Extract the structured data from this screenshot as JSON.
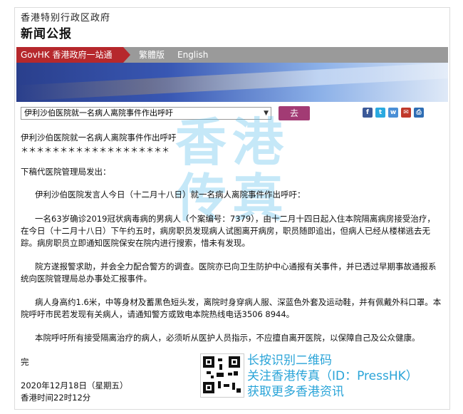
{
  "header": {
    "subtitle": "香港特别行政区政府",
    "title": "新闻公报"
  },
  "nav": {
    "govhk": "GovHK 香港政府一站通",
    "traditional": "繁體版",
    "english": "English"
  },
  "toolbar": {
    "select_value": "伊利沙伯医院就一名病人离院事件作出呼吁",
    "go_label": "去"
  },
  "share_icons": [
    "facebook-icon",
    "twitter-icon",
    "weibo-icon",
    "email-icon",
    "print-icon"
  ],
  "article": {
    "headline": "伊利沙伯医院就一名病人离院事件作出呼吁",
    "stars": "＊＊＊＊＊＊＊＊＊＊＊＊＊＊＊＊＊＊＊",
    "intro": "下稿代医院管理局发出：",
    "p1": "伊利沙伯医院发言人今日（十二月十八日）就一名病人离院事件作出呼吁：",
    "p2_l1": "一名63岁确诊2019冠状病毒病的男病人（个案编号：7379），由十二月十四日起入住本院隔离病房接受治疗，",
    "p2_l2": "在今日（十二月十八日）下午约五时，病房职员发现病人试图离开病房，职员随即追出，但病人已经从楼梯逃去无",
    "p2_l3": "踪。病房职员立即通知医院保安在院内进行搜索，惜未有发现。",
    "p3_l1": "院方遂报警求助，并会全力配合警方的调查。医院亦已向卫生防护中心通报有关事件，并已透过早期事故通报系",
    "p3_l2": "统向医院管理局总办事处汇报事件。",
    "p4_l1": "病人身高约1.6米，中等身材及蓄黑色短头发，离院时身穿病人服、深蓝色外套及运动鞋，并有佩戴外科口罩。本",
    "p4_l2": "院呼吁市民若发现有关病人，请通知警方或致电本院热线电话3506 8944。",
    "p5": "本院呼吁所有接受隔离治疗的病人，必须听从医护人员指示，不应擅自离开医院，以保障自己及公众健康。",
    "end": "完",
    "date": "2020年12月18日（星期五）",
    "time": "香港时间22时12分"
  },
  "watermark": "香港\n传真",
  "promo": {
    "line1": "长按识别二维码",
    "line2": "关注香港传真（ID：PressHK）",
    "line3": "获取更多香港资讯"
  },
  "colors": {
    "govhk_red": "#b6282c",
    "go_button": "#a23b74",
    "promo_blue": "#2aa4d8"
  }
}
